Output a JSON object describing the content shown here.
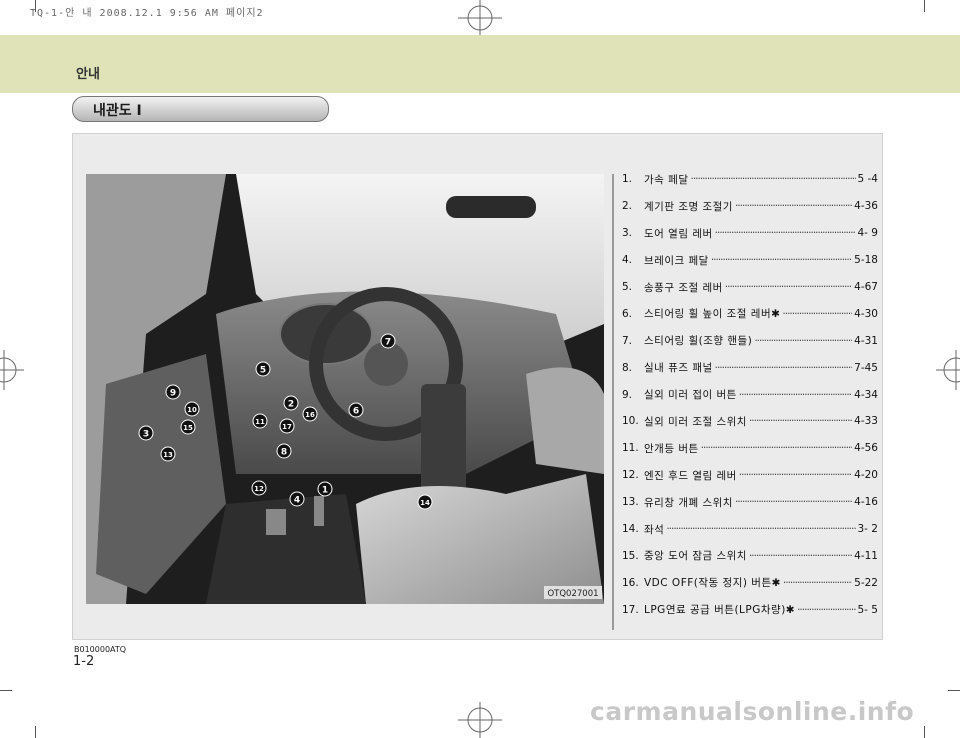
{
  "print_header": "TQ-1-안 내  2008.12.1 9:56 AM 페이지2",
  "section": "안내",
  "title": "내관도 I",
  "image_code": "OTQ027001",
  "legend": [
    {
      "num": "1.",
      "name": "가속 페달",
      "page": "5 -4"
    },
    {
      "num": "2.",
      "name": "계기판 조명 조절기",
      "page": "4-36"
    },
    {
      "num": "3.",
      "name": "도어 열림 레버",
      "page": "4- 9"
    },
    {
      "num": "4.",
      "name": "브레이크 페달",
      "page": "5-18"
    },
    {
      "num": "5.",
      "name": "송풍구 조절 레버",
      "page": "4-67"
    },
    {
      "num": "6.",
      "name": "스티어링 휠 높이 조절 레버✱",
      "page": "4-30"
    },
    {
      "num": "7.",
      "name": "스티어링 휠(조향 핸들)",
      "page": "4-31"
    },
    {
      "num": "8.",
      "name": "실내 퓨즈 패널",
      "page": "7-45"
    },
    {
      "num": "9.",
      "name": "실외 미러 접이 버튼",
      "page": "4-34"
    },
    {
      "num": "10.",
      "name": "실외 미러 조절 스위치",
      "page": "4-33"
    },
    {
      "num": "11.",
      "name": "안개등 버튼",
      "page": "4-56"
    },
    {
      "num": "12.",
      "name": "엔진 후드 열림 레버",
      "page": "4-20"
    },
    {
      "num": "13.",
      "name": "유리창 개폐 스위치",
      "page": "4-16"
    },
    {
      "num": "14.",
      "name": "좌석",
      "page": "3- 2"
    },
    {
      "num": "15.",
      "name": "중앙 도어 잠금 스위치",
      "page": "4-11"
    },
    {
      "num": "16.",
      "name": "VDC OFF(작동 정지) 버튼✱",
      "page": "5-22"
    },
    {
      "num": "17.",
      "name": "LPG연료 공급 버튼(LPG차량)✱",
      "page": "5- 5"
    }
  ],
  "badges": [
    "1",
    "2",
    "3",
    "4",
    "5",
    "6",
    "7",
    "8",
    "9",
    "10",
    "11",
    "12",
    "13",
    "14",
    "15",
    "16",
    "17"
  ],
  "doc_code": "B010000ATQ",
  "page_number": "1-2",
  "watermark": "carmanualsonline.info"
}
